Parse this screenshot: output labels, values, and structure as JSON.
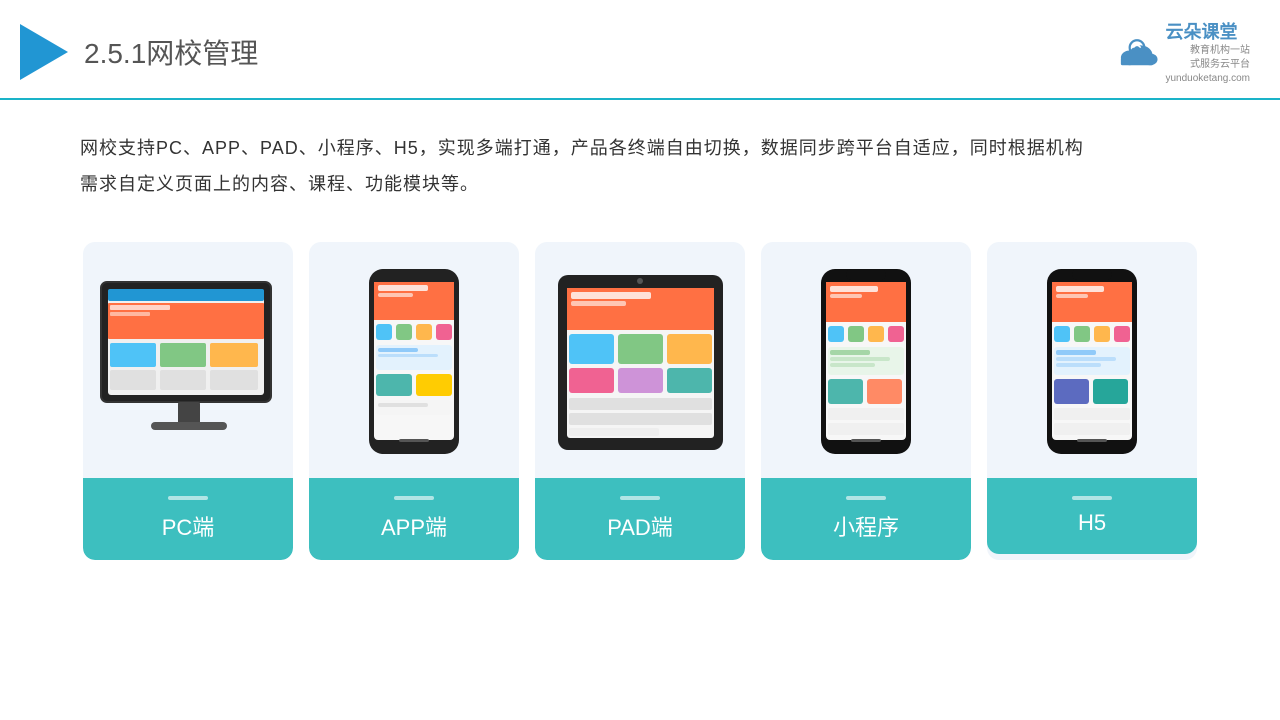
{
  "header": {
    "title_prefix": "2.5.1",
    "title_main": "网校管理",
    "logo_text": "云朵课堂",
    "logo_sub_line1": "教育机构一站",
    "logo_sub_line2": "式服务云平台",
    "logo_domain": "yunduoketang.com"
  },
  "description": {
    "text_line1": "网校支持PC、APP、PAD、小程序、H5，实现多端打通，产品各终端自由切换，数据同步跨平台自适应，同时根据机构",
    "text_line2": "需求自定义页面上的内容、课程、功能模块等。"
  },
  "cards": [
    {
      "id": "pc",
      "label": "PC端"
    },
    {
      "id": "app",
      "label": "APP端"
    },
    {
      "id": "pad",
      "label": "PAD端"
    },
    {
      "id": "miniprogram",
      "label": "小程序"
    },
    {
      "id": "h5",
      "label": "H5"
    }
  ],
  "brand_color": "#3dbfbf",
  "accent_color": "#2196d3"
}
